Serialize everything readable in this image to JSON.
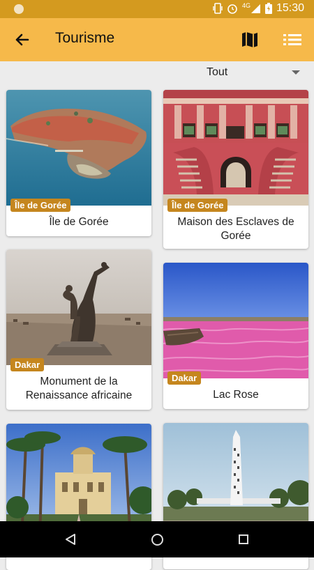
{
  "status_bar": {
    "time": "15:30",
    "signal": "4G"
  },
  "app_bar": {
    "title": "Tourisme"
  },
  "filter": {
    "selected": "Tout"
  },
  "places": [
    {
      "name": "Île de Gorée",
      "region": "Île de Gorée"
    },
    {
      "name": "Maison des Esclaves de Gorée",
      "region": "Île de Gorée"
    },
    {
      "name": "Monument de la Renaissance africaine",
      "region": "Dakar"
    },
    {
      "name": "Lac Rose",
      "region": "Dakar"
    },
    {
      "name": "",
      "region": ""
    },
    {
      "name": "",
      "region": ""
    }
  ],
  "colors": {
    "status_bar": "#d49a1f",
    "app_bar": "#f6b94a",
    "badge": "#c5861e"
  }
}
